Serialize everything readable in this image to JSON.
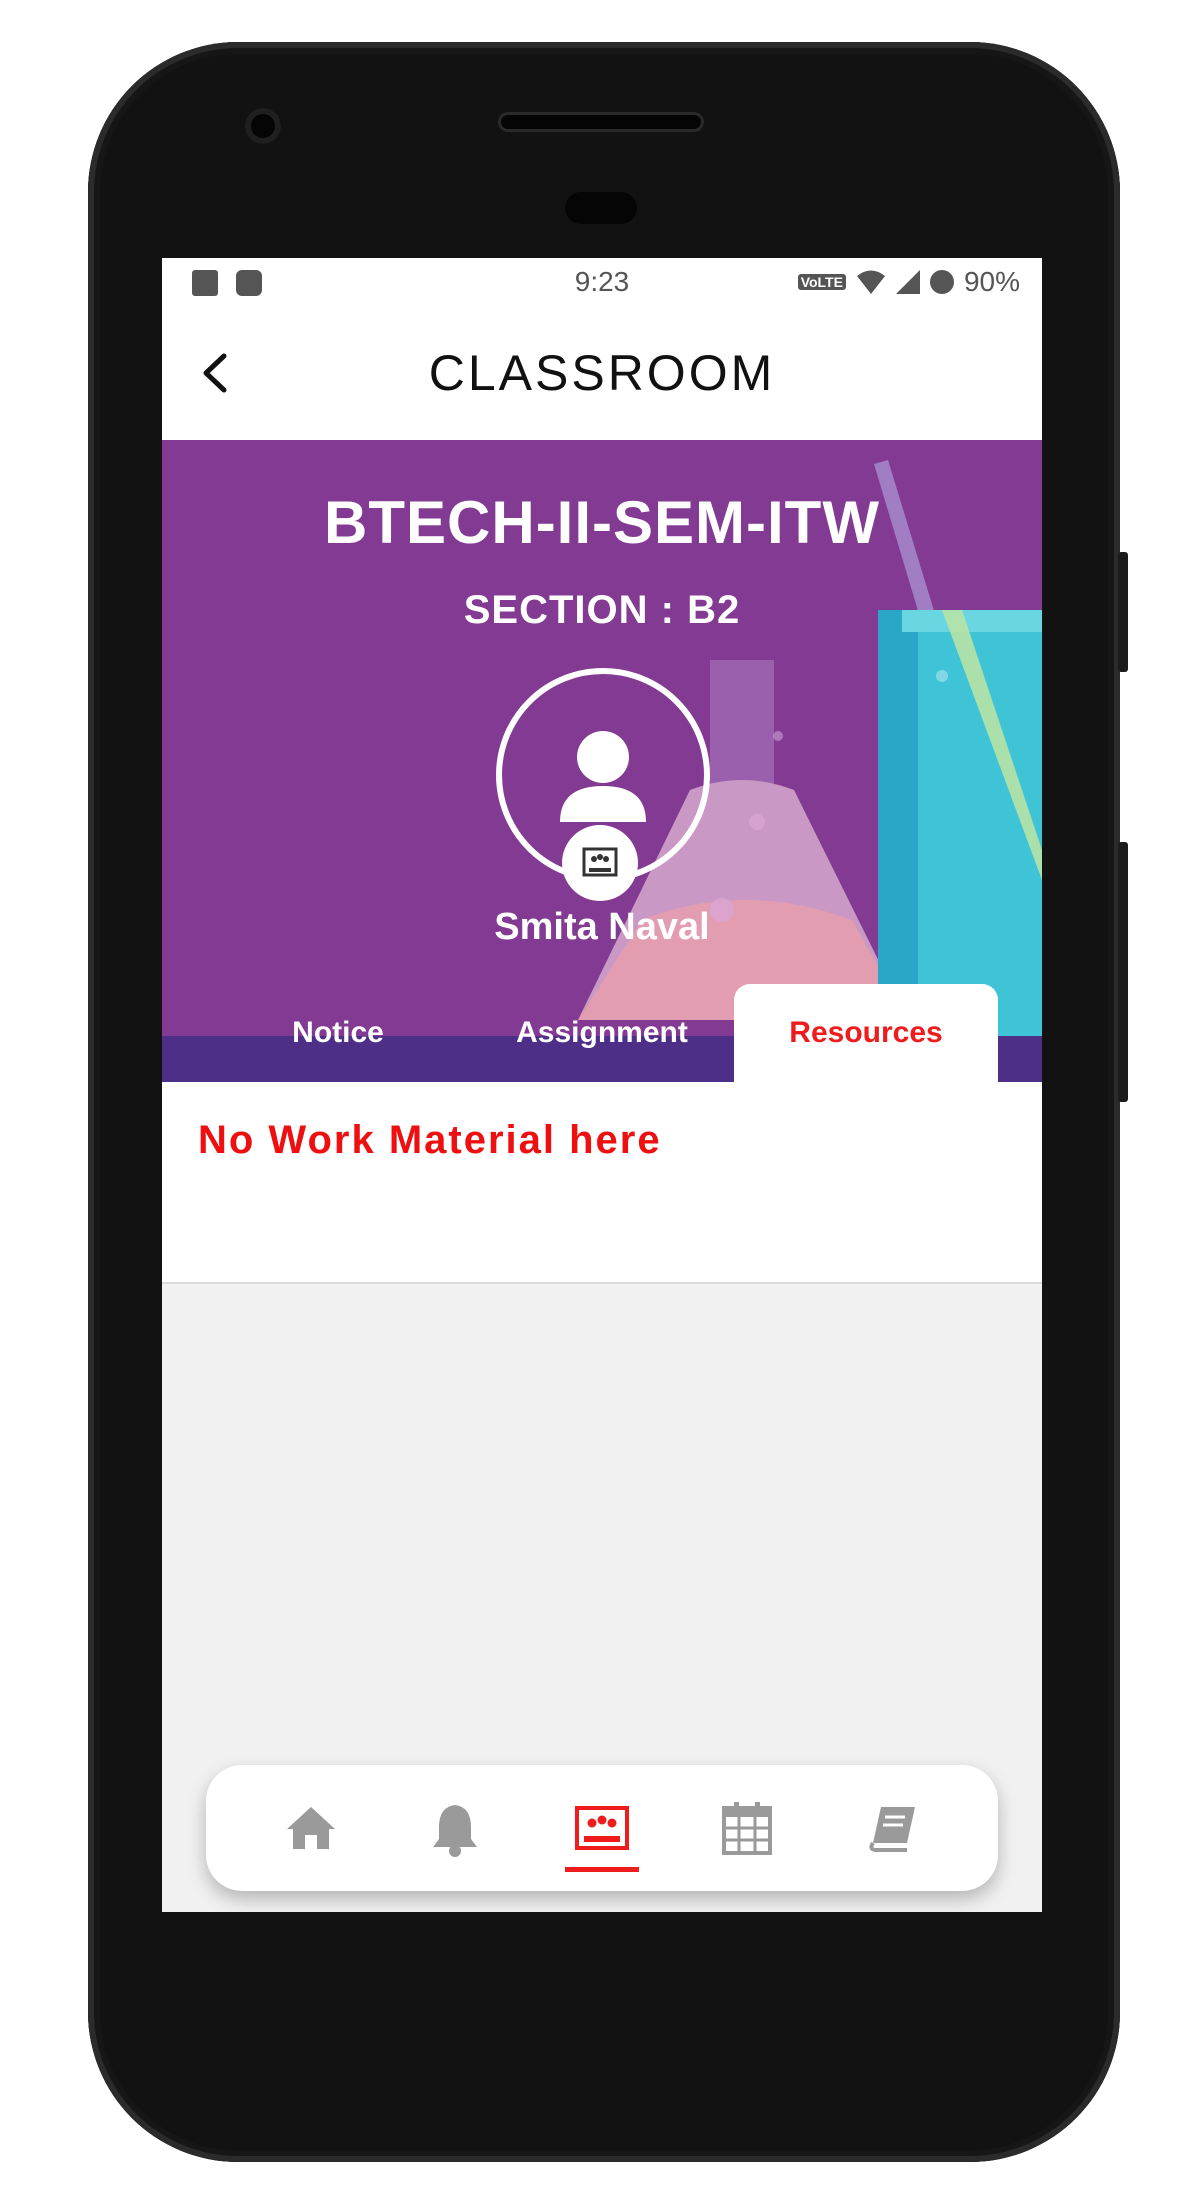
{
  "status_bar": {
    "time": "9:23",
    "network": "VoLTE",
    "battery": "90%"
  },
  "app_bar": {
    "title": "CLASSROOM"
  },
  "banner": {
    "class_name": "BTECH-II-SEM-ITW",
    "section": "SECTION : B2",
    "teacher_name": "Smita Naval"
  },
  "tabs": [
    {
      "label": "Notice",
      "active": false
    },
    {
      "label": "Assignment",
      "active": false
    },
    {
      "label": "Resources",
      "active": true
    }
  ],
  "content": {
    "empty_message": "No Work Material here"
  },
  "bottom_nav": {
    "items": [
      "home-icon",
      "bell-icon",
      "classroom-icon",
      "calendar-icon",
      "book-icon"
    ],
    "active": "classroom-icon"
  },
  "colors": {
    "banner": "#823a92",
    "banner_bottom": "#4e2f88",
    "accent": "#ee1c1c",
    "inactive_icon": "#9a9a9a"
  }
}
